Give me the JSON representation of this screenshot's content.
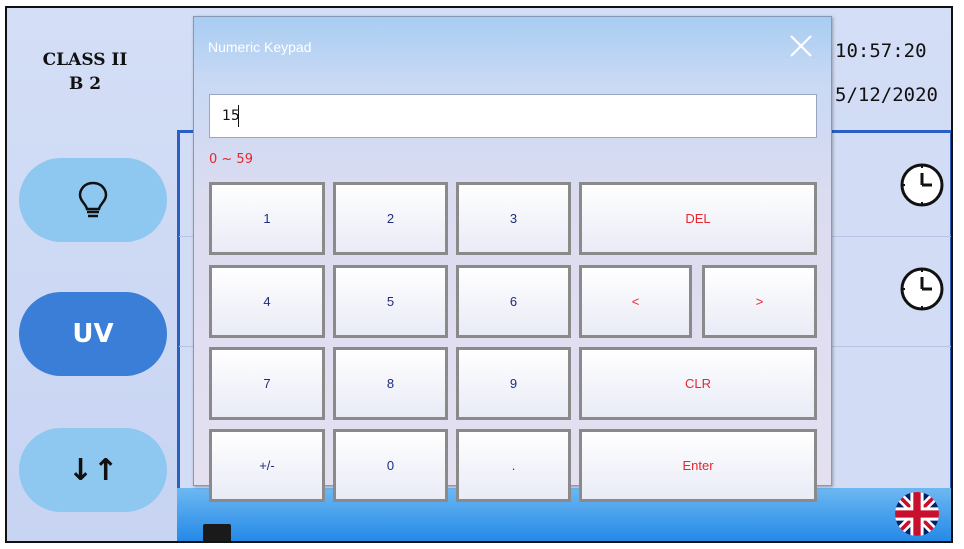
{
  "app": {
    "cabinet_class": "CLASS II",
    "cabinet_model": "B 2",
    "time": "10:57:20",
    "date": "5/12/2020",
    "side_buttons": {
      "light_icon": "lightbulb-icon",
      "uv_label": "UV",
      "sort_label": "↓↑"
    },
    "clock_icon": "clock-icon",
    "language_flag": "uk-flag-icon"
  },
  "keypad": {
    "title": "Numeric Keypad",
    "input_value": "15",
    "range_hint": "0 ~ 59",
    "keys": {
      "k1": "1",
      "k2": "2",
      "k3": "3",
      "del": "DEL",
      "k4": "4",
      "k5": "5",
      "k6": "6",
      "left": "<",
      "right": ">",
      "k7": "7",
      "k8": "8",
      "k9": "9",
      "clr": "CLR",
      "sign": "+/-",
      "k0": "0",
      "dot": ".",
      "enter": "Enter"
    },
    "colors": {
      "digit": "#1f2c7a",
      "action": "#e8262d",
      "title_bar": "#a8cdf2"
    }
  }
}
